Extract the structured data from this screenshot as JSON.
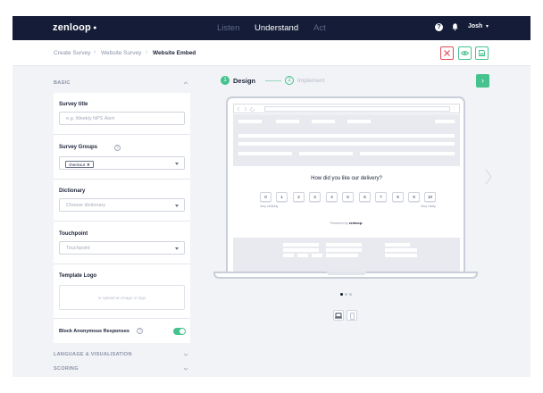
{
  "nav": {
    "logo": "zenloop",
    "items": [
      {
        "label": "Listen"
      },
      {
        "label": "Understand"
      },
      {
        "label": "Act"
      }
    ],
    "help_symbol": "?",
    "user": "Josh",
    "user_caret": "▾"
  },
  "breadcrumb": {
    "items": [
      "Create Survey",
      "Website Survey",
      "Website Embed"
    ],
    "separator": "›"
  },
  "actions": {
    "close_icon": "x-icon",
    "preview_icon": "eye-icon",
    "save_icon": "save-icon"
  },
  "sidebar": {
    "basic_label": "BASIC",
    "survey_title": {
      "label": "Survey title",
      "placeholder": "e.g. Weekly NPS Alert"
    },
    "survey_groups": {
      "label": "Survey Groups",
      "info": "?",
      "chip": "checkout",
      "chip_remove": "✕"
    },
    "dictionary": {
      "label": "Dictionary",
      "placeholder": "Choose dictionary"
    },
    "touchpoint": {
      "label": "Touchpoint",
      "placeholder": "Touchpoint"
    },
    "template_logo": {
      "label": "Template Logo",
      "upload_text": "or upload an image or logo"
    },
    "block_anon": {
      "label": "Block Anonymous Responses",
      "info": "?",
      "enabled": true
    },
    "sections": [
      {
        "label": "LANGUAGE & VISUALISATION"
      },
      {
        "label": "SCORING"
      }
    ]
  },
  "stepper": {
    "steps": [
      {
        "number": "1",
        "label": "Design",
        "active": true
      },
      {
        "number": "2",
        "label": "Implement",
        "active": false
      }
    ],
    "next_symbol": "›"
  },
  "preview": {
    "question": "How did you like our delivery?",
    "scale": [
      "0",
      "1",
      "2",
      "3",
      "4",
      "5",
      "6",
      "7",
      "8",
      "9",
      "10"
    ],
    "low_label": "Very Unlikely",
    "high_label": "Very Likely",
    "powered_prefix": "Powered by",
    "powered_brand": "zenloop",
    "carousel_pages": 3,
    "carousel_active": 1
  },
  "colors": {
    "nav_bg": "#141c37",
    "accent_green": "#46c28e",
    "danger_red": "#e24b57",
    "canvas_bg": "#f1f3f6"
  }
}
